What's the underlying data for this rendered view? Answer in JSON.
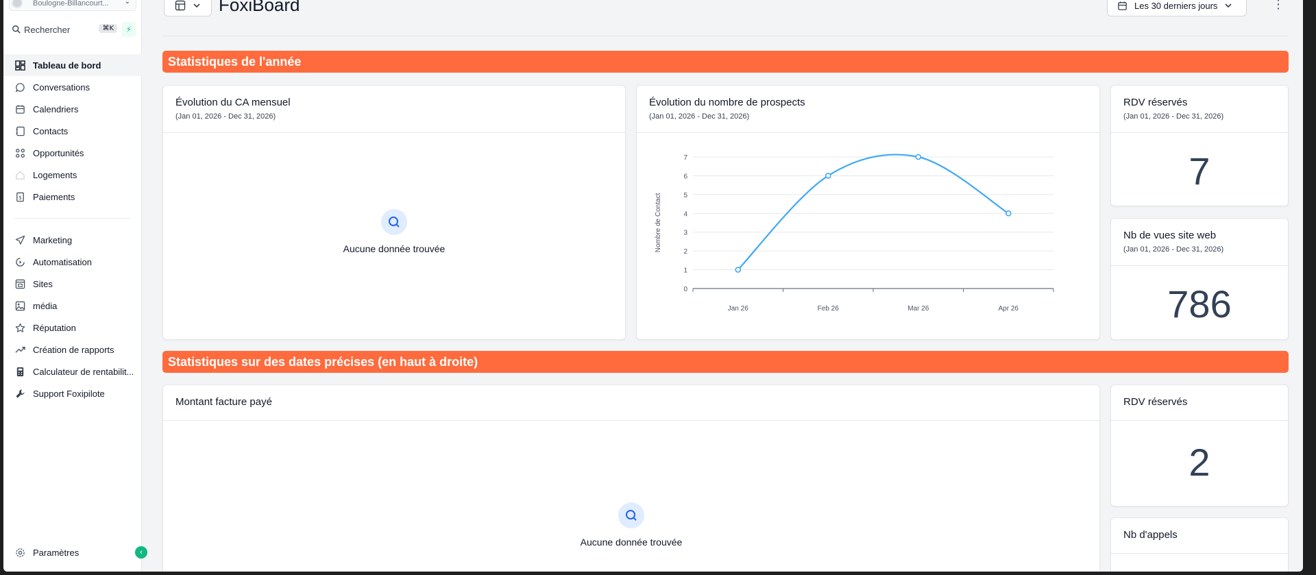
{
  "sidebar": {
    "location": "Boulogne-Billancourt...",
    "search_label": "Rechercher",
    "search_shortcut": "⌘K",
    "items": [
      {
        "label": "Tableau de bord",
        "icon": "dashboard-icon"
      },
      {
        "label": "Conversations",
        "icon": "chat-icon"
      },
      {
        "label": "Calendriers",
        "icon": "calendar-icon"
      },
      {
        "label": "Contacts",
        "icon": "contacts-icon"
      },
      {
        "label": "Opportunités",
        "icon": "opportunities-icon"
      },
      {
        "label": "Logements",
        "icon": "home-icon"
      },
      {
        "label": "Paiements",
        "icon": "payments-icon"
      }
    ],
    "items2": [
      {
        "label": "Marketing",
        "icon": "send-icon"
      },
      {
        "label": "Automatisation",
        "icon": "automation-icon"
      },
      {
        "label": "Sites",
        "icon": "sites-icon"
      },
      {
        "label": "média",
        "icon": "image-icon"
      },
      {
        "label": "Réputation",
        "icon": "star-icon"
      },
      {
        "label": "Création de rapports",
        "icon": "trending-icon"
      },
      {
        "label": "Calculateur de rentabilit...",
        "icon": "calculator-icon"
      },
      {
        "label": "Support Foxipilote",
        "icon": "wrench-icon"
      }
    ],
    "settings_label": "Paramètres"
  },
  "header": {
    "title": "FoxiBoard",
    "date_range": "Les 30 derniers jours"
  },
  "sections": {
    "year": "Statistiques de l'année",
    "dates": "Statistiques sur des dates précises (en haut à droite)"
  },
  "cards": {
    "ca": {
      "title": "Évolution du CA mensuel",
      "sub": "(Jan 01, 2026 - Dec 31, 2026)",
      "empty": "Aucune donnée trouvée"
    },
    "prospects": {
      "title": "Évolution du nombre de prospects",
      "sub": "(Jan 01, 2026 - Dec 31, 2026)"
    },
    "rdv_year": {
      "title": "RDV réservés",
      "sub": "(Jan 01, 2026 - Dec 31, 2026)",
      "value": "7"
    },
    "views": {
      "title": "Nb de vues site web",
      "sub": "(Jan 01, 2026 - Dec 31, 2026)",
      "value": "786"
    },
    "invoice": {
      "title": "Montant facture payé",
      "empty": "Aucune donnée trouvée"
    },
    "rdv_dates": {
      "title": "RDV réservés",
      "value": "2"
    },
    "calls": {
      "title": "Nb d'appels"
    }
  },
  "chart_data": {
    "type": "line",
    "categories": [
      "Jan 26",
      "Feb 26",
      "Mar 26",
      "Apr 26"
    ],
    "series": [
      {
        "values": [
          1,
          6,
          7,
          4
        ],
        "color": "#3fa9f5"
      }
    ],
    "ylabel": "Nombre de Contact",
    "yticks": [
      0,
      1,
      2,
      3,
      4,
      5,
      6,
      7
    ],
    "ylim": [
      0,
      7
    ],
    "grid": true
  },
  "colors": {
    "accent": "#ff6b3d",
    "line": "#3fa9f5",
    "success": "#10b981"
  }
}
